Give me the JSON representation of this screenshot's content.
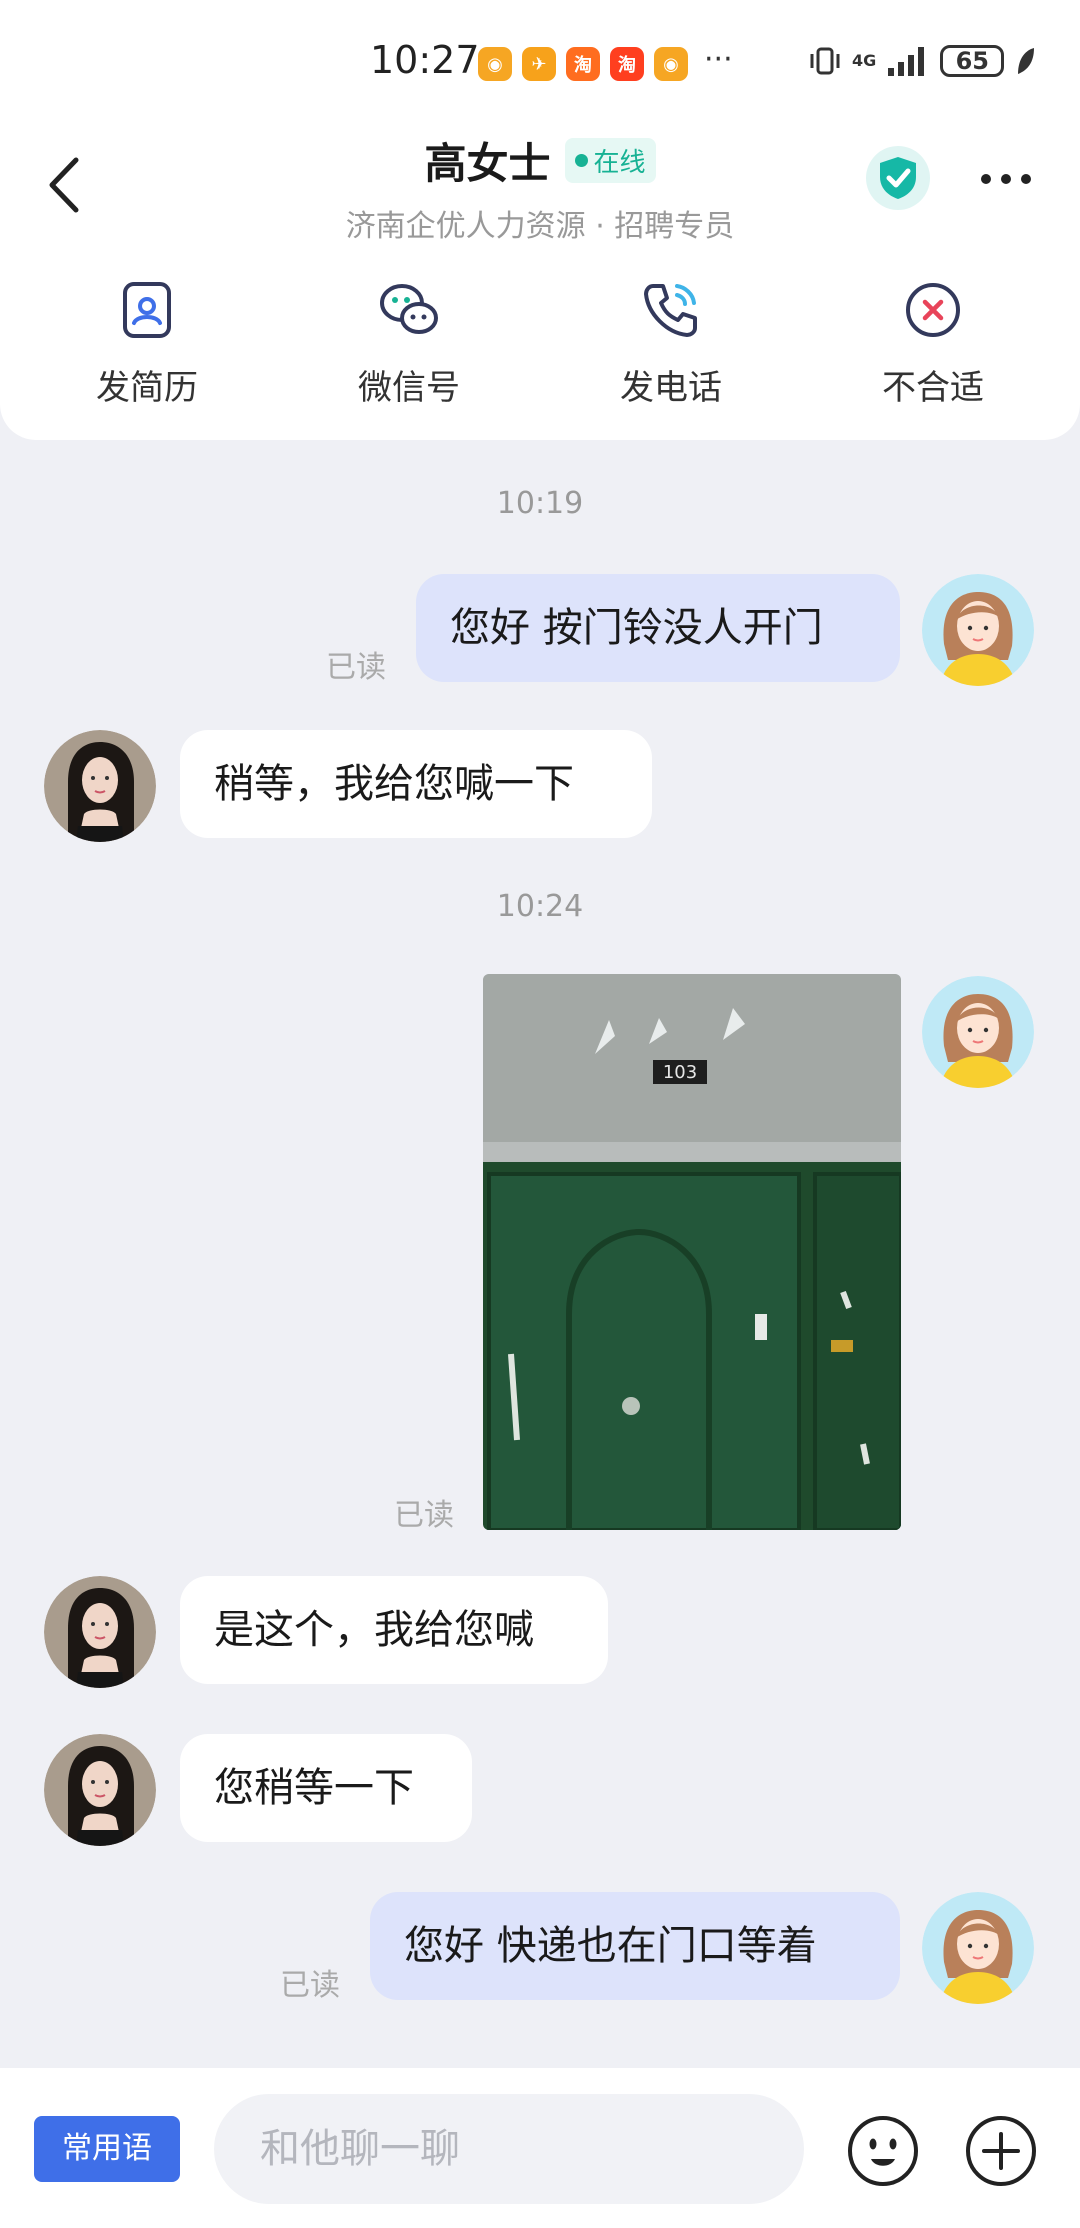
{
  "status_bar": {
    "time": "10:27",
    "app_icons": [
      {
        "name": "weibo-icon",
        "glyph": "◉",
        "color": "#f6a623"
      },
      {
        "name": "fliggy-icon",
        "glyph": "✈",
        "color": "#f7a21b"
      },
      {
        "name": "taobao-icon",
        "glyph": "淘",
        "color": "#ff6d1f"
      },
      {
        "name": "taobao-icon",
        "glyph": "淘",
        "color": "#ff3f1f"
      },
      {
        "name": "weibo-icon",
        "glyph": "◉",
        "color": "#f6a623"
      }
    ],
    "more": "···",
    "network": "4G",
    "battery": "65"
  },
  "header": {
    "title": "高女士",
    "online_label": "在线",
    "subtitle": "济南企优人力资源 · 招聘专员",
    "actions": [
      {
        "label": "发简历",
        "icon": "resume-icon"
      },
      {
        "label": "微信号",
        "icon": "wechat-icon"
      },
      {
        "label": "发电话",
        "icon": "phone-call-icon"
      },
      {
        "label": "不合适",
        "icon": "reject-icon"
      }
    ]
  },
  "chat": {
    "time_1": "10:19",
    "msg_1": "您好 按门铃没人开门",
    "read_1": "已读",
    "msg_2": "稍等，我给您喊一下",
    "time_2": "10:24",
    "photo_door_number": "103",
    "read_2": "已读",
    "msg_3": "是这个，我给您喊",
    "msg_4": "您稍等一下",
    "msg_5": "您好 快递也在门口等着",
    "read_3": "已读"
  },
  "bottom_bar": {
    "quick_phrases_label": "常用语",
    "input_placeholder": "和他聊一聊",
    "input_value": ""
  },
  "colors": {
    "accent": "#3f6fe8",
    "online": "#17b294",
    "my_bubble": "#dde3fb",
    "background": "#eff0f5"
  }
}
